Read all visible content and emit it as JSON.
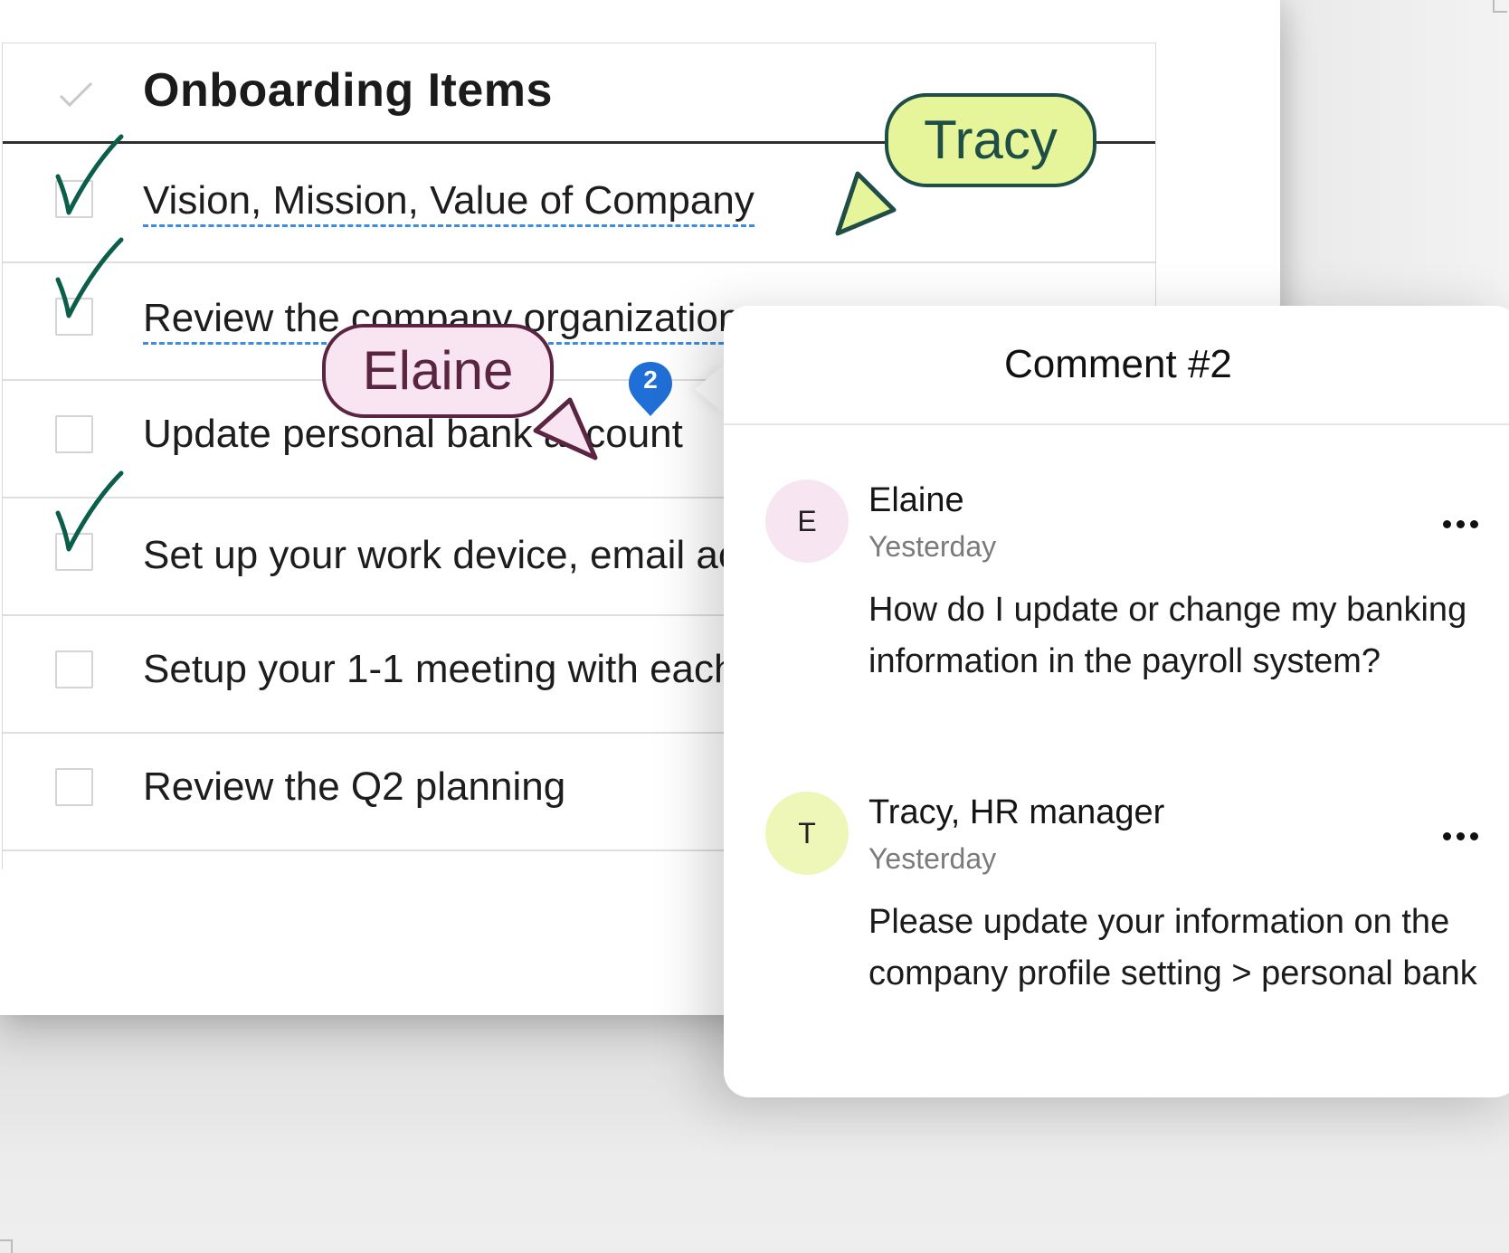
{
  "table": {
    "title": "Onboarding Items",
    "rows": [
      {
        "text": "Vision, Mission, Value of Company",
        "checked": true,
        "underlined": true
      },
      {
        "text": "Review the company organization",
        "checked": true,
        "underlined": true
      },
      {
        "text": "Update personal bank account",
        "checked": false,
        "underlined": false
      },
      {
        "text": "Set up your work device, email ac",
        "checked": true,
        "underlined": false
      },
      {
        "text": "Setup your 1-1 meeting with each",
        "checked": false,
        "underlined": false
      },
      {
        "text": "Review the Q2 planning",
        "checked": false,
        "underlined": false
      }
    ]
  },
  "comment_badge": {
    "count": "2",
    "color": "#1f6fd6"
  },
  "comment_panel": {
    "title": "Comment #2",
    "comments": [
      {
        "avatar_initial": "E",
        "avatar_color": "#f7e6f1",
        "author": "Elaine",
        "time": "Yesterday",
        "body": "How do I update or change my banking information in the payroll system?",
        "more_icon": "more-horizontal-icon"
      },
      {
        "avatar_initial": "T",
        "avatar_color": "#eef7b8",
        "author": "Tracy, HR manager",
        "time": "Yesterday",
        "body": "Please update your information on the company profile setting > personal bank",
        "more_icon": "more-horizontal-icon"
      }
    ]
  },
  "cursors": [
    {
      "name": "Tracy",
      "fill": "#e6f59a",
      "stroke": "#1f4e47"
    },
    {
      "name": "Elaine",
      "fill": "#f9e4f2",
      "stroke": "#5a2540"
    }
  ],
  "colors": {
    "check_mark": "#0b5e4a",
    "link_underline": "#3a8de0"
  }
}
